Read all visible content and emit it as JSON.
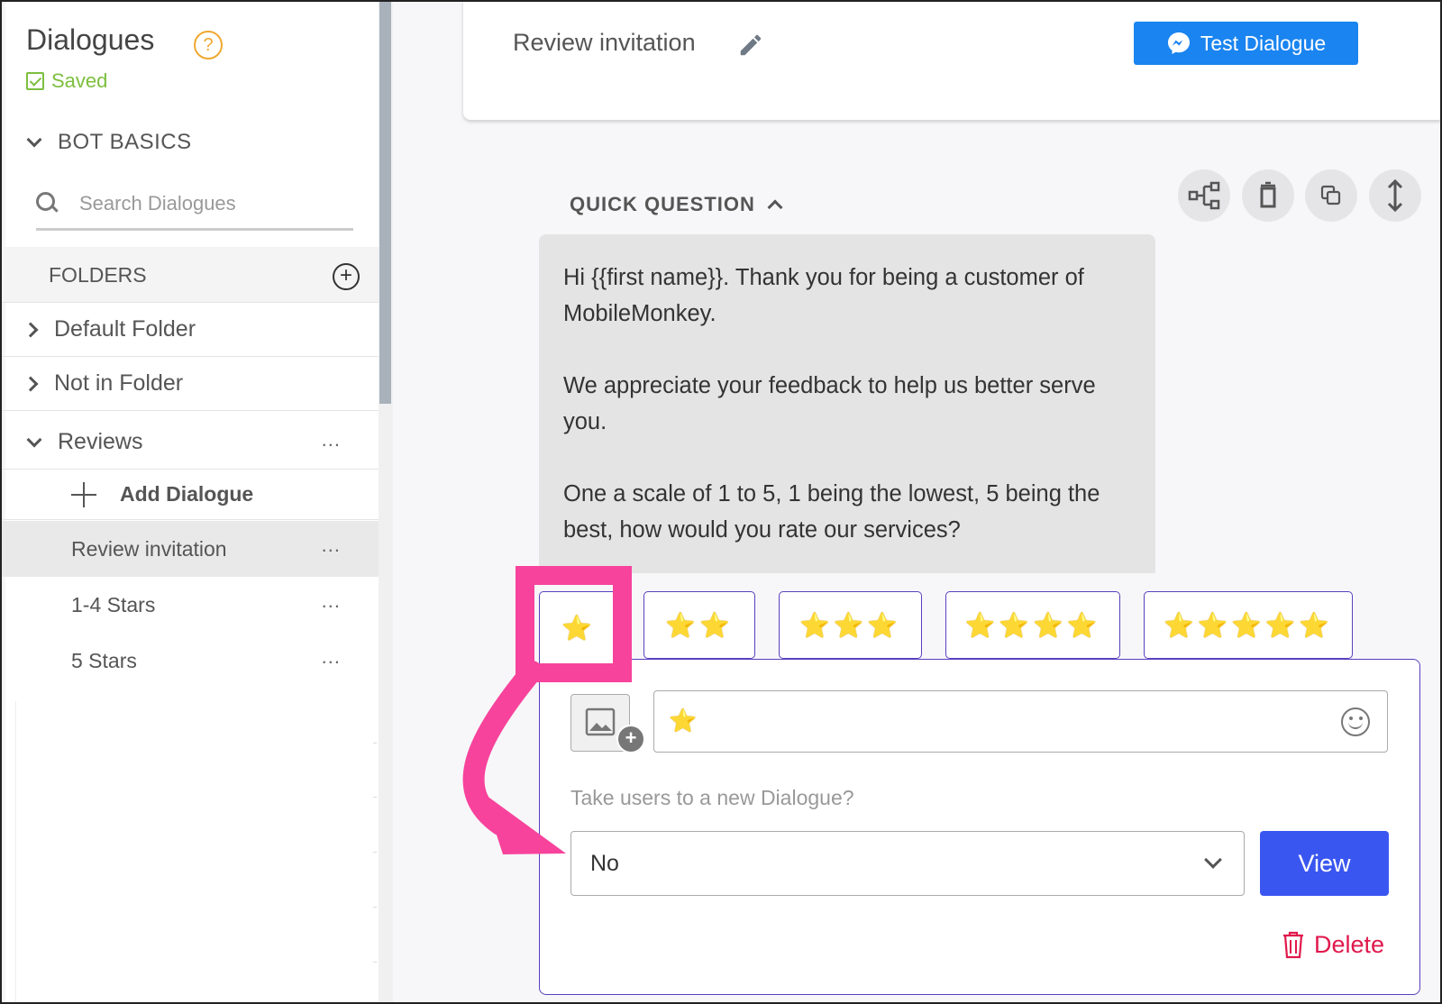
{
  "sidebar": {
    "title": "Dialogues",
    "help_glyph": "?",
    "saved_label": "Saved",
    "section_label": "BOT BASICS",
    "search_placeholder": "Search Dialogues",
    "folders_label": "FOLDERS",
    "folders": [
      {
        "name": "Default Folder",
        "expanded": false
      },
      {
        "name": "Not in Folder",
        "expanded": false
      },
      {
        "name": "Reviews",
        "expanded": true
      }
    ],
    "menu_dots": "...",
    "add_dialogue_label": "Add Dialogue",
    "dialogues": [
      {
        "name": "Review invitation",
        "active": true
      },
      {
        "name": "1-4 Stars",
        "active": false
      },
      {
        "name": "5 Stars",
        "active": false
      }
    ]
  },
  "header": {
    "dialogue_title": "Review invitation",
    "test_button_label": "Test Dialogue"
  },
  "widget": {
    "type_label": "QUICK QUESTION",
    "tools": [
      "connections-icon",
      "trash-icon",
      "copy-icon",
      "resize-vertical-icon"
    ],
    "message_paragraphs": [
      "Hi {{first name}}. Thank you for being a customer of MobileMonkey.",
      "We appreciate your feedback to help us better serve you.",
      "One a scale of 1 to 5, 1 being the lowest, 5 being the best, how would you rate our services?"
    ],
    "quick_replies": [
      "⭐",
      "⭐⭐",
      "⭐⭐⭐",
      "⭐⭐⭐⭐",
      "⭐⭐⭐⭐⭐"
    ],
    "selected_reply_index": 0,
    "reply_text_value": "⭐",
    "question_label": "Take users to a new Dialogue?",
    "select_value": "No",
    "view_button_label": "View",
    "delete_label": "Delete"
  },
  "colors": {
    "accent_blue": "#3a56f0",
    "messenger_blue": "#1a84f0",
    "saved_green": "#7cbf3f",
    "help_orange": "#f0a830",
    "panel_border": "#5a3fbf",
    "delete_red": "#e0184c",
    "annotation_pink": "#f7439c"
  }
}
